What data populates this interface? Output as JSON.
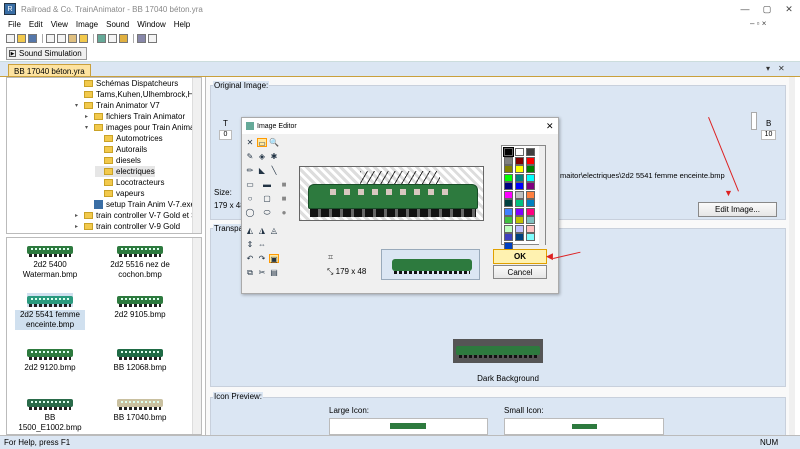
{
  "window": {
    "title": "Railroad & Co. TrainAnimator - BB 17040 béton.yra"
  },
  "menu": [
    "File",
    "Edit",
    "View",
    "Image",
    "Sound",
    "Window",
    "Help"
  ],
  "simulation_button": "Sound Simulation",
  "doc_tab": "BB 17040 béton.yra",
  "tree": [
    {
      "label": "Schémas Dispatcheurs",
      "indent": 0,
      "exp": ""
    },
    {
      "label": "Tams,Kuhen,Ulhembrock,Horr",
      "indent": 0,
      "exp": ""
    },
    {
      "label": "Train Animator V7",
      "indent": 0,
      "exp": "▾"
    },
    {
      "label": "fichiers Train Animator",
      "indent": 1,
      "exp": "▸"
    },
    {
      "label": "images pour Train Animat",
      "indent": 1,
      "exp": "▾"
    },
    {
      "label": "Automotrices",
      "indent": 2,
      "exp": ""
    },
    {
      "label": "Autorails",
      "indent": 2,
      "exp": ""
    },
    {
      "label": "diesels",
      "indent": 2,
      "exp": ""
    },
    {
      "label": "electriques",
      "indent": 2,
      "exp": ""
    },
    {
      "label": "Locotracteurs",
      "indent": 2,
      "exp": ""
    },
    {
      "label": "vapeurs",
      "indent": 2,
      "exp": ""
    },
    {
      "label": "setup Train Anim V-7.exe",
      "indent": 1,
      "exp": ""
    },
    {
      "label": "train controller V-7 Gold et Sy",
      "indent": 0,
      "exp": "▸"
    },
    {
      "label": "train controller V-9 Gold",
      "indent": 0,
      "exp": "▸"
    }
  ],
  "thumbnails": [
    {
      "label": "2d2 5400 Waterman.bmp",
      "color": "#2d7a3e"
    },
    {
      "label": "2d2 5516 nez de cochon.bmp",
      "color": "#2d7a3e"
    },
    {
      "label": "2d2 5541 femme enceinte.bmp",
      "color": "#2a9a7e"
    },
    {
      "label": "2d2 9105.bmp",
      "color": "#2d7a3e"
    },
    {
      "label": "2d2 9120.bmp",
      "color": "#2d7a3e"
    },
    {
      "label": "BB 12068.bmp",
      "color": "#1f6b45"
    },
    {
      "label": "BB 1500_E1002.bmp",
      "color": "#2a6b4a"
    },
    {
      "label": "BB 17040.bmp",
      "color": "#c9c0a0"
    }
  ],
  "right": {
    "original_image_label": "Original Image:",
    "t_label": "T",
    "t_value": "0",
    "b_label": "B",
    "b_value": "10",
    "path_text": "maitor\\electriques\\2d2 5541 femme enceinte.bmp",
    "size_label": "Size:",
    "size_value": "179 x 48",
    "edit_button": "Edit Image...",
    "transparency_label": "Transpa",
    "preview_size": "179 x 48",
    "dark_background_label": "Dark Background",
    "icon_preview_label": "Icon Preview:",
    "large_icon_label": "Large Icon:",
    "small_icon_label": "Small Icon:"
  },
  "dialog": {
    "title": "Image Editor",
    "ok": "OK",
    "cancel": "Cancel",
    "palette": [
      "#000000",
      "#ffffff",
      "#404040",
      "#808080",
      "#800000",
      "#ff0000",
      "#808000",
      "#ffff00",
      "#008000",
      "#00ff00",
      "#008080",
      "#00ffff",
      "#000080",
      "#0000ff",
      "#800080",
      "#ff00ff",
      "#c0c0c0",
      "#ff8040",
      "#004040",
      "#00c080",
      "#0080c0",
      "#4080ff",
      "#8000ff",
      "#ff0080",
      "#40c040",
      "#c0c000",
      "#80c0c0",
      "#c0ffc0",
      "#c0c0ff",
      "#ffc0c0",
      "#4040c0",
      "#004080",
      "#80ffff",
      "#0040c0"
    ]
  },
  "status": {
    "left": "For Help, press F1",
    "right": "NUM"
  },
  "colors": {
    "accent_tab": "#fde3a0",
    "loco_green": "#2d7a3e",
    "arrow_red": "#d22222",
    "ok_bg": "#fff2b0"
  }
}
